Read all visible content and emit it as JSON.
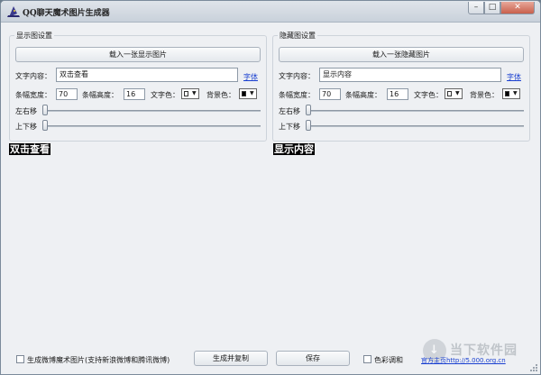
{
  "window": {
    "title": "QQ聊天魔术图片生成器",
    "minimize": "–",
    "maximize": "□",
    "close": "✕"
  },
  "display_group": {
    "title": "显示图设置",
    "load_button": "载入一张显示图片",
    "text_label": "文字内容：",
    "text_value": "双击查看",
    "font_link": "字体",
    "width_label": "条幅宽度：",
    "width_value": "70",
    "height_label": "条幅高度：",
    "height_value": "16",
    "text_color_label": "文字色：",
    "bg_color_label": "背景色：",
    "h_move_label": "左右移",
    "v_move_label": "上下移",
    "h_move_level": 0,
    "v_move_level": 0
  },
  "hidden_group": {
    "title": "隐藏图设置",
    "load_button": "载入一张隐藏图片",
    "text_label": "文字内容：",
    "text_value": "显示内容",
    "font_link": "字体",
    "width_label": "条幅宽度：",
    "width_value": "70",
    "height_label": "条幅高度：",
    "height_value": "16",
    "text_color_label": "文字色：",
    "bg_color_label": "背景色：",
    "h_move_label": "左右移",
    "v_move_label": "上下移",
    "h_move_level": 0,
    "v_move_level": 0
  },
  "previews": {
    "display": "双击查看",
    "hidden": "显示内容"
  },
  "bottom": {
    "weibo_checkbox": "生成微博魔术图片(支持新浪微博和腾讯微博)",
    "generate_button": "生成并复制",
    "save_button": "保存",
    "color_checkbox": "色彩调和",
    "home_link": "官方主页http://5.000.org.cn"
  },
  "watermark": {
    "text": "当下软件园"
  },
  "colors": {
    "text_color": "#ffffff",
    "bg_color": "#000000",
    "link": "#1a40d0"
  }
}
